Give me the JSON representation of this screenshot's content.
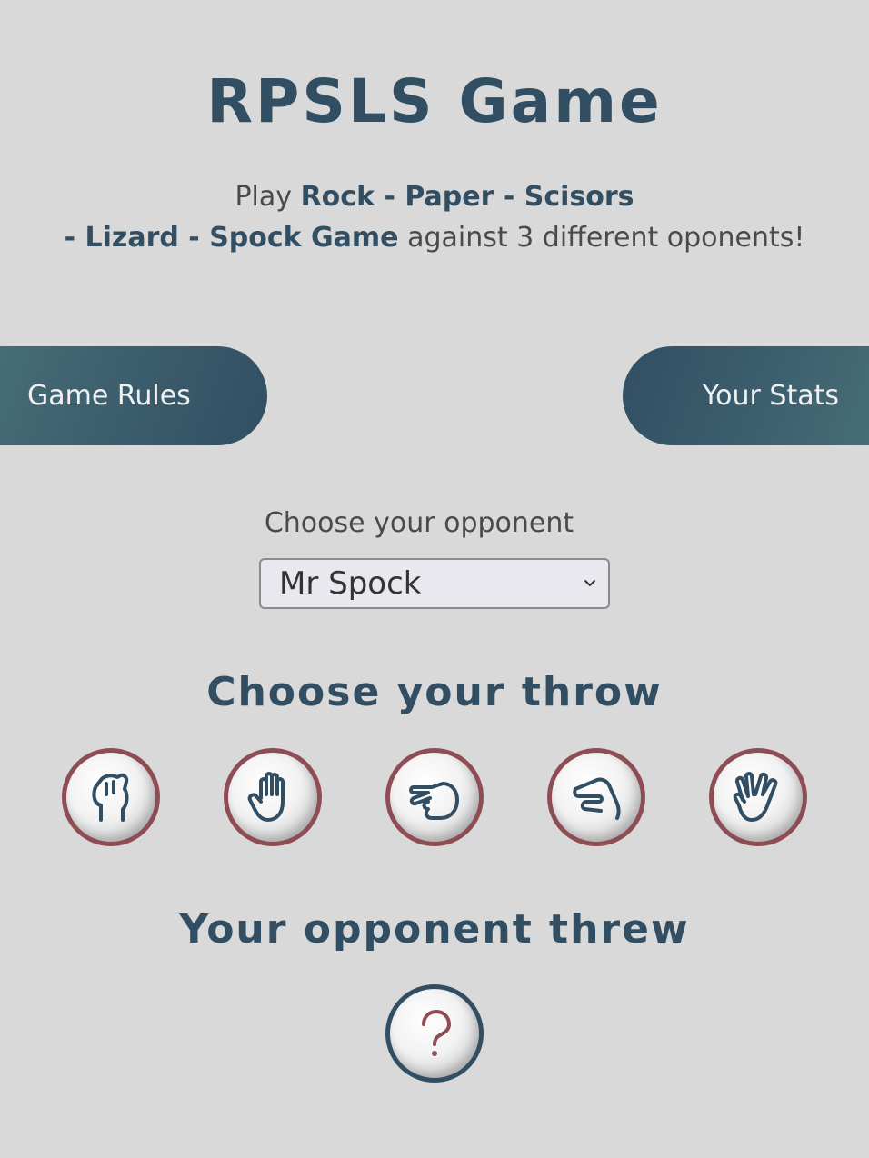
{
  "header": {
    "title": "RPSLS Game",
    "intro": {
      "prefix": "Play",
      "game_name_line1": "Rock - Paper - Scisors",
      "game_name_line2": "- Lizard - Spock Game",
      "suffix": "against 3 different oponents!"
    }
  },
  "nav": {
    "rules_label": "Game Rules",
    "stats_label": "Your Stats"
  },
  "opponent": {
    "label": "Choose your opponent",
    "selected": "Mr Spock"
  },
  "throw_section": {
    "title": "Choose your throw",
    "throws": [
      "rock-icon",
      "paper-icon",
      "scissors-icon",
      "lizard-icon",
      "spock-icon"
    ]
  },
  "opponent_section": {
    "title": "Your opponent threw",
    "result_icon": "question-mark-icon"
  },
  "colors": {
    "background": "#d9d9d9",
    "primary": "#324e63",
    "accent": "#8e4d55",
    "teal": "#466d76"
  }
}
